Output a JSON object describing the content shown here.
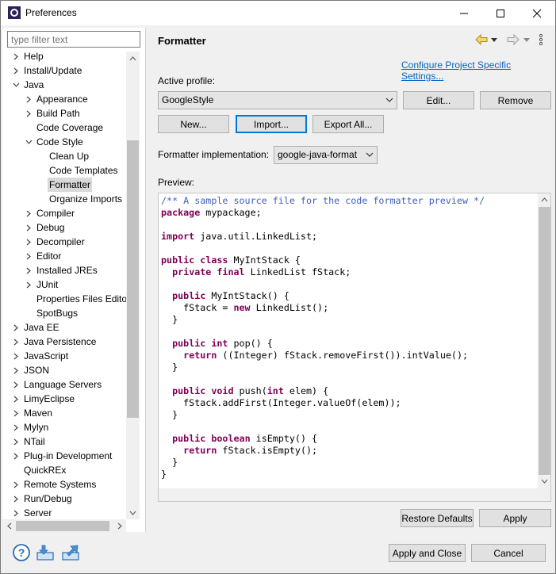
{
  "window": {
    "title": "Preferences"
  },
  "filter": {
    "placeholder": "type filter text"
  },
  "tree": [
    {
      "label": "Help",
      "level": 0,
      "arrow": "right"
    },
    {
      "label": "Install/Update",
      "level": 0,
      "arrow": "right"
    },
    {
      "label": "Java",
      "level": 0,
      "arrow": "down"
    },
    {
      "label": "Appearance",
      "level": 1,
      "arrow": "right"
    },
    {
      "label": "Build Path",
      "level": 1,
      "arrow": "right"
    },
    {
      "label": "Code Coverage",
      "level": 1,
      "arrow": "none"
    },
    {
      "label": "Code Style",
      "level": 1,
      "arrow": "down"
    },
    {
      "label": "Clean Up",
      "level": 2,
      "arrow": "none"
    },
    {
      "label": "Code Templates",
      "level": 2,
      "arrow": "none"
    },
    {
      "label": "Formatter",
      "level": 2,
      "arrow": "none",
      "selected": true
    },
    {
      "label": "Organize Imports",
      "level": 2,
      "arrow": "none"
    },
    {
      "label": "Compiler",
      "level": 1,
      "arrow": "right"
    },
    {
      "label": "Debug",
      "level": 1,
      "arrow": "right"
    },
    {
      "label": "Decompiler",
      "level": 1,
      "arrow": "right"
    },
    {
      "label": "Editor",
      "level": 1,
      "arrow": "right"
    },
    {
      "label": "Installed JREs",
      "level": 1,
      "arrow": "right"
    },
    {
      "label": "JUnit",
      "level": 1,
      "arrow": "right"
    },
    {
      "label": "Properties Files Editor",
      "level": 1,
      "arrow": "none"
    },
    {
      "label": "SpotBugs",
      "level": 1,
      "arrow": "none"
    },
    {
      "label": "Java EE",
      "level": 0,
      "arrow": "right"
    },
    {
      "label": "Java Persistence",
      "level": 0,
      "arrow": "right"
    },
    {
      "label": "JavaScript",
      "level": 0,
      "arrow": "right"
    },
    {
      "label": "JSON",
      "level": 0,
      "arrow": "right"
    },
    {
      "label": "Language Servers",
      "level": 0,
      "arrow": "right"
    },
    {
      "label": "LimyEclipse",
      "level": 0,
      "arrow": "right"
    },
    {
      "label": "Maven",
      "level": 0,
      "arrow": "right"
    },
    {
      "label": "Mylyn",
      "level": 0,
      "arrow": "right"
    },
    {
      "label": "NTail",
      "level": 0,
      "arrow": "right"
    },
    {
      "label": "Plug-in Development",
      "level": 0,
      "arrow": "right"
    },
    {
      "label": "QuickREx",
      "level": 0,
      "arrow": "none"
    },
    {
      "label": "Remote Systems",
      "level": 0,
      "arrow": "right"
    },
    {
      "label": "Run/Debug",
      "level": 0,
      "arrow": "right"
    },
    {
      "label": "Server",
      "level": 0,
      "arrow": "right"
    }
  ],
  "page": {
    "title": "Formatter",
    "configure_link": "Configure Project Specific Settings...",
    "active_profile_label": "Active profile:",
    "active_profile_value": "GoogleStyle",
    "edit_label": "Edit...",
    "remove_label": "Remove",
    "new_label": "New...",
    "import_label": "Import...",
    "export_label": "Export All...",
    "impl_label": "Formatter implementation:",
    "impl_value": "google-java-format",
    "preview_label": "Preview:",
    "restore_label": "Restore Defaults",
    "apply_label": "Apply"
  },
  "code_lines": [
    [
      {
        "t": "cm",
        "v": "/** A sample source file for the code formatter preview */"
      }
    ],
    [
      {
        "t": "kw",
        "v": "package"
      },
      {
        "t": "n",
        "v": " mypackage;"
      }
    ],
    [],
    [
      {
        "t": "kw",
        "v": "import"
      },
      {
        "t": "n",
        "v": " java.util.LinkedList;"
      }
    ],
    [],
    [
      {
        "t": "kw",
        "v": "public"
      },
      {
        "t": "n",
        "v": " "
      },
      {
        "t": "kw",
        "v": "class"
      },
      {
        "t": "n",
        "v": " MyIntStack {"
      }
    ],
    [
      {
        "t": "n",
        "v": "  "
      },
      {
        "t": "kw",
        "v": "private"
      },
      {
        "t": "n",
        "v": " "
      },
      {
        "t": "kw",
        "v": "final"
      },
      {
        "t": "n",
        "v": " LinkedList fStack;"
      }
    ],
    [],
    [
      {
        "t": "n",
        "v": "  "
      },
      {
        "t": "kw",
        "v": "public"
      },
      {
        "t": "n",
        "v": " MyIntStack() {"
      }
    ],
    [
      {
        "t": "n",
        "v": "    fStack = "
      },
      {
        "t": "kw",
        "v": "new"
      },
      {
        "t": "n",
        "v": " LinkedList();"
      }
    ],
    [
      {
        "t": "n",
        "v": "  }"
      }
    ],
    [],
    [
      {
        "t": "n",
        "v": "  "
      },
      {
        "t": "kw",
        "v": "public"
      },
      {
        "t": "n",
        "v": " "
      },
      {
        "t": "kw",
        "v": "int"
      },
      {
        "t": "n",
        "v": " pop() {"
      }
    ],
    [
      {
        "t": "n",
        "v": "    "
      },
      {
        "t": "kw",
        "v": "return"
      },
      {
        "t": "n",
        "v": " ((Integer) fStack.removeFirst()).intValue();"
      }
    ],
    [
      {
        "t": "n",
        "v": "  }"
      }
    ],
    [],
    [
      {
        "t": "n",
        "v": "  "
      },
      {
        "t": "kw",
        "v": "public"
      },
      {
        "t": "n",
        "v": " "
      },
      {
        "t": "kw",
        "v": "void"
      },
      {
        "t": "n",
        "v": " push("
      },
      {
        "t": "kw",
        "v": "int"
      },
      {
        "t": "n",
        "v": " elem) {"
      }
    ],
    [
      {
        "t": "n",
        "v": "    fStack.addFirst(Integer.valueOf(elem));"
      }
    ],
    [
      {
        "t": "n",
        "v": "  }"
      }
    ],
    [],
    [
      {
        "t": "n",
        "v": "  "
      },
      {
        "t": "kw",
        "v": "public"
      },
      {
        "t": "n",
        "v": " "
      },
      {
        "t": "kw",
        "v": "boolean"
      },
      {
        "t": "n",
        "v": " isEmpty() {"
      }
    ],
    [
      {
        "t": "n",
        "v": "    "
      },
      {
        "t": "kw",
        "v": "return"
      },
      {
        "t": "n",
        "v": " fStack.isEmpty();"
      }
    ],
    [
      {
        "t": "n",
        "v": "  }"
      }
    ],
    [
      {
        "t": "n",
        "v": "}"
      }
    ]
  ],
  "footer": {
    "apply_close_label": "Apply and Close",
    "cancel_label": "Cancel"
  },
  "icons": {
    "help": "help-icon",
    "import": "import-preferences-icon",
    "export": "export-preferences-icon"
  },
  "colors": {
    "keyword": "#7f0055",
    "comment": "#3f5fbf",
    "link": "#0066cc",
    "selection": "#d9d9d9"
  }
}
